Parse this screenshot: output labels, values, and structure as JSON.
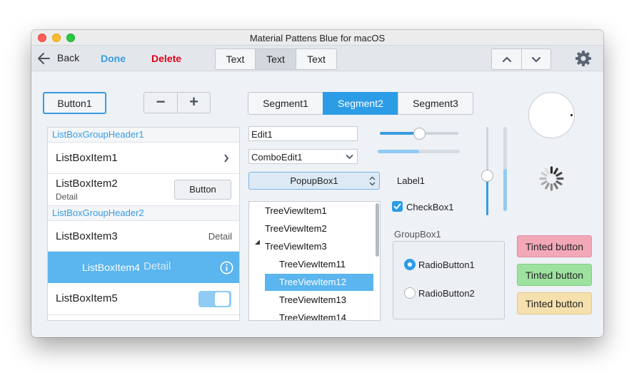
{
  "window": {
    "title": "Material Pattens Blue for macOS"
  },
  "toolbar": {
    "back_label": "Back",
    "done_label": "Done",
    "delete_label": "Delete",
    "text_segments": [
      "Text",
      "Text",
      "Text"
    ],
    "up_icon": "chevron-up-icon",
    "down_icon": "chevron-down-icon",
    "settings_icon": "gear-icon"
  },
  "controls": {
    "button1_label": "Button1",
    "minus_label": "−",
    "plus_label": "+",
    "segments": [
      "Segment1",
      "Segment2",
      "Segment3"
    ],
    "edit_value": "Edit1",
    "combo_value": "ComboEdit1",
    "popup_value": "PopupBox1",
    "label1": "Label1",
    "checkbox_label": "CheckBox1",
    "groupbox_title": "GroupBox1",
    "radio1_label": "RadioButton1",
    "radio2_label": "RadioButton2",
    "tinted_buttons": [
      "Tinted button",
      "Tinted button",
      "Tinted button"
    ],
    "slider_value": 0.5,
    "progress_value": 0.5,
    "vslider_value": 0.45,
    "vprogress_value": 0.5
  },
  "listbox": {
    "header1": "ListBoxGroupHeader1",
    "item1": "ListBoxItem1",
    "item2": "ListBoxItem2",
    "item2_detail": "Detail",
    "item2_button": "Button",
    "header2": "ListBoxGroupHeader2",
    "item3": "ListBoxItem3",
    "item3_detail": "Detail",
    "item4": "ListBoxItem4",
    "item4_detail": "Detail",
    "item5": "ListBoxItem5"
  },
  "tree": {
    "items": [
      "TreeViewItem1",
      "TreeViewItem2",
      "TreeViewItem3",
      "TreeViewItem11",
      "TreeViewItem12",
      "TreeViewItem13",
      "TreeViewItem14"
    ]
  },
  "colors": {
    "accent": "#3a9be0",
    "danger": "#e3001b",
    "selection": "#5bb5ee"
  }
}
